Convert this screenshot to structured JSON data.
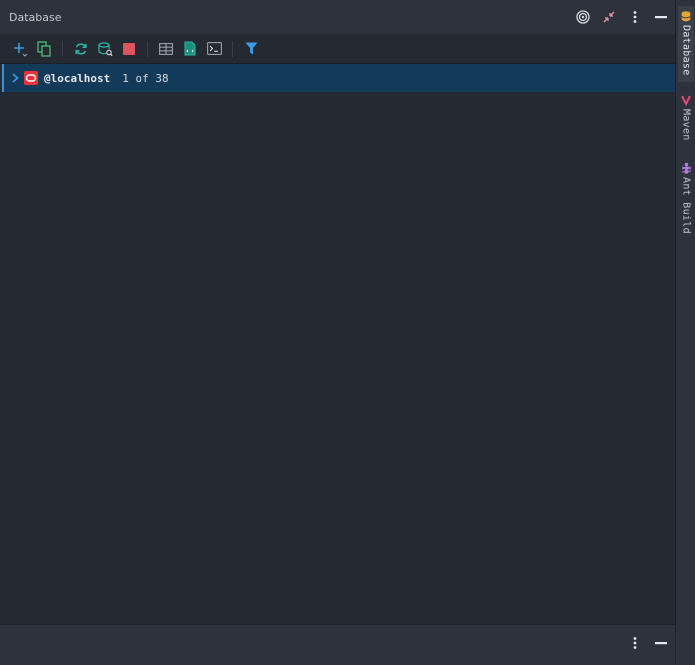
{
  "panel": {
    "title": "Database"
  },
  "toolbar": {
    "buttons": [
      "new",
      "duplicate",
      "refresh",
      "schema-search",
      "stop",
      "table-view",
      "edit-source",
      "console",
      "filter"
    ]
  },
  "tree": {
    "rows": [
      {
        "name": "@localhost",
        "count": "1 of 38",
        "icon": "oracle-db-icon",
        "expanded": false,
        "selected": true
      }
    ]
  },
  "side_tabs": [
    {
      "label": "Database",
      "icon": "database-icon",
      "active": true
    },
    {
      "label": "Maven",
      "icon": "maven-icon",
      "active": false
    },
    {
      "label": "Ant Build",
      "icon": "ant-icon",
      "active": false
    }
  ],
  "colors": {
    "background": "#252932",
    "header": "#2d323c",
    "selection": "#143a5a",
    "accent": "#3b8fd6",
    "oracle_red": "#e8323c",
    "stop_red": "#e0525d",
    "green": "#4dbd74",
    "teal": "#2ab7a9",
    "filter_blue": "#3b9be8"
  }
}
